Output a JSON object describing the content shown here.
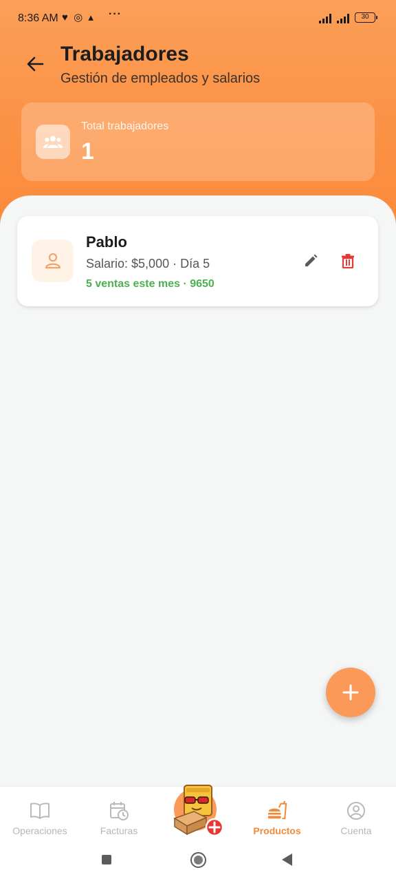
{
  "status_bar": {
    "time": "8:36 AM",
    "notif_icons": "♥ ◎ ▴",
    "more": "···",
    "battery": "30"
  },
  "header": {
    "title": "Trabajadores",
    "subtitle": "Gestión de empleados y salarios"
  },
  "stats": {
    "label": "Total trabajadores",
    "value": "1",
    "icon": "group-icon"
  },
  "workers": [
    {
      "name": "Pablo",
      "salary_line": "Salario: $5,000 · Día 5",
      "sales_line": "5 ventas este mes · 9650"
    }
  ],
  "bottom_nav": {
    "items": [
      {
        "label": "Operaciones",
        "icon": "book-icon",
        "active": false
      },
      {
        "label": "Facturas",
        "icon": "calendar-clock-icon",
        "active": false
      },
      {
        "label": "Productos",
        "icon": "fastfood-icon",
        "active": true
      },
      {
        "label": "Cuenta",
        "icon": "account-circle-icon",
        "active": false
      }
    ],
    "center_icon": "mascot-add-icon"
  },
  "colors": {
    "accent": "#fb9245",
    "success": "#4caf50",
    "danger": "#e53935"
  }
}
